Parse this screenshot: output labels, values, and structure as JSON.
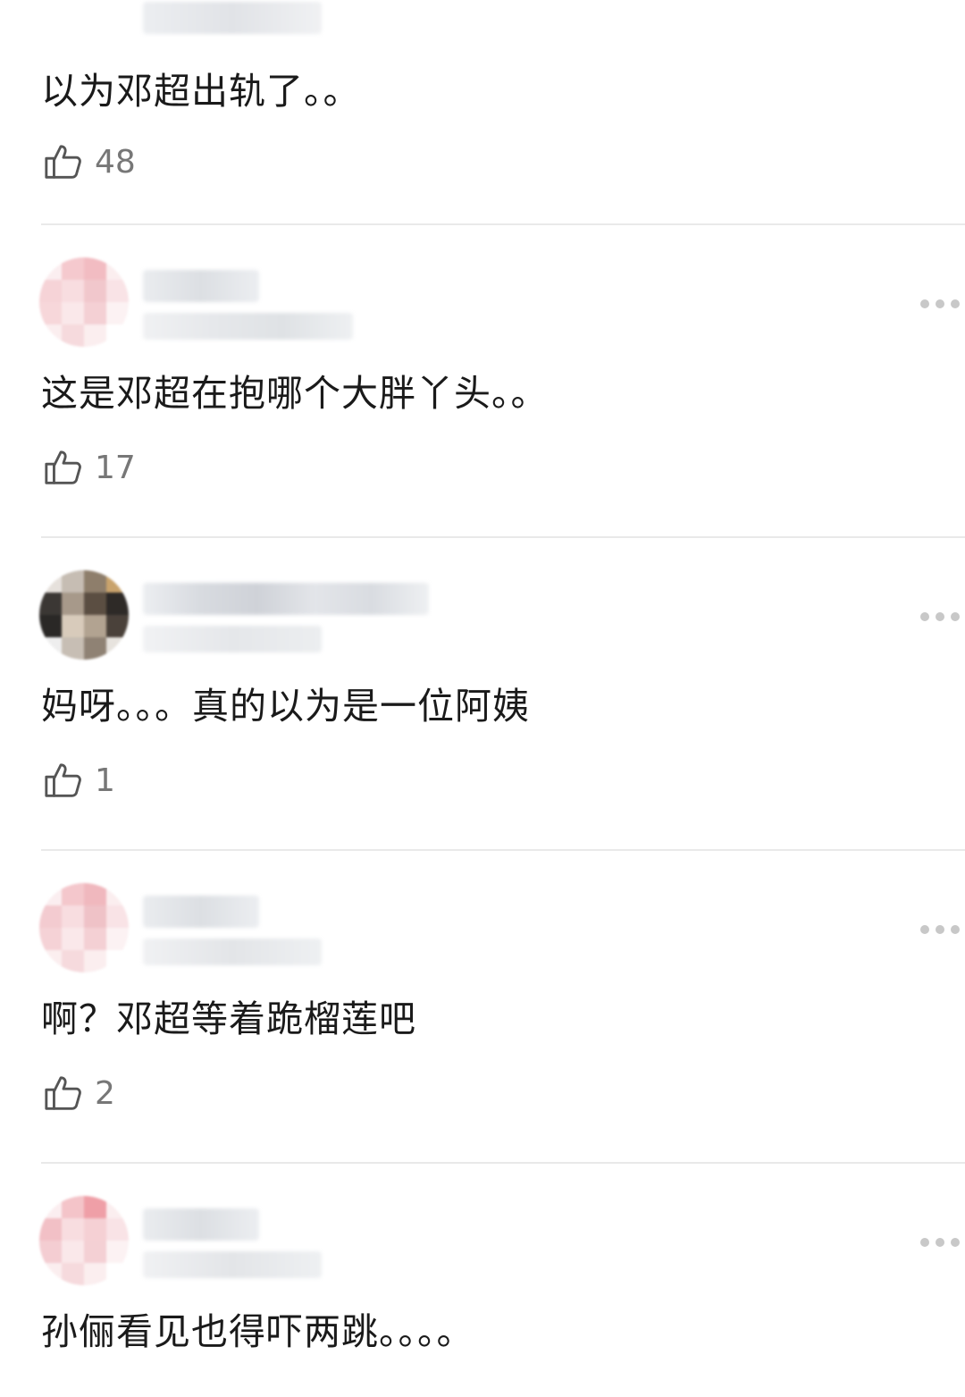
{
  "comments": [
    {
      "text": "以为邓超出轨了。。",
      "likes": "48",
      "avatar_tone": "pink"
    },
    {
      "text": "这是邓超在抱哪个大胖丫头。。",
      "likes": "17",
      "avatar_tone": "pink"
    },
    {
      "text": "妈呀。。。真的以为是一位阿姨",
      "likes": "1",
      "avatar_tone": "dark"
    },
    {
      "text": "啊？邓超等着跪榴莲吧",
      "likes": "2",
      "avatar_tone": "pink"
    },
    {
      "text": "孙俪看见也得吓两跳。。。。",
      "likes": "",
      "avatar_tone": "pink"
    }
  ],
  "icons": {
    "like": "thumbs-up-icon",
    "more": "more-dots-icon"
  },
  "colors": {
    "divider": "#e9e9e9",
    "text": "#1a1a1a",
    "meta": "#777777"
  }
}
